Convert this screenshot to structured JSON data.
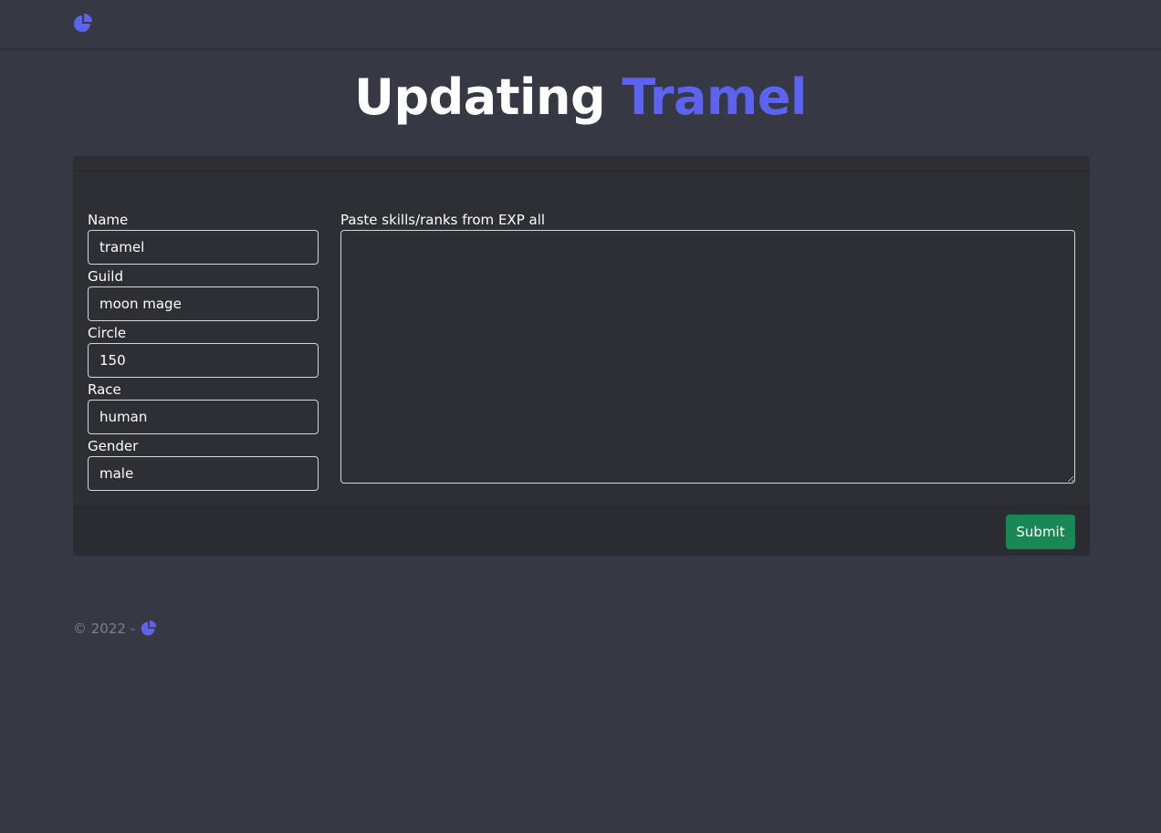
{
  "colors": {
    "background": "#363943",
    "card": "#2e2f35",
    "accent": "#5c63ee",
    "submit": "#198754",
    "footer_text": "#7c7f89"
  },
  "nav": {
    "logo_icon": "pie-chart-icon"
  },
  "heading": {
    "prefix": "Updating",
    "name": "Tramel"
  },
  "form": {
    "name": {
      "label": "Name",
      "value": "tramel"
    },
    "guild": {
      "label": "Guild",
      "value": "moon mage"
    },
    "circle": {
      "label": "Circle",
      "value": "150"
    },
    "race": {
      "label": "Race",
      "value": "human"
    },
    "gender": {
      "label": "Gender",
      "value": "male"
    },
    "paste": {
      "label": "Paste skills/ranks from EXP all",
      "value": ""
    },
    "submit_label": "Submit"
  },
  "footer": {
    "copyright": "© 2022 -",
    "logo_icon": "pie-chart-icon"
  }
}
